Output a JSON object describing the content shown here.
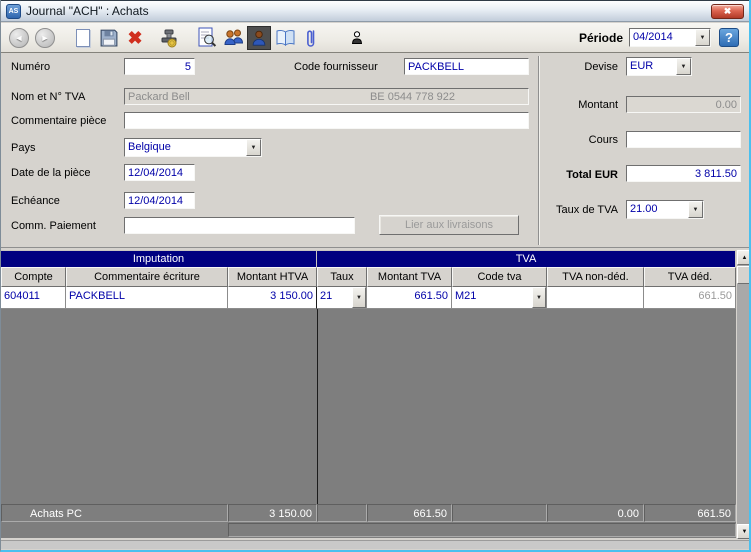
{
  "colors": {
    "group_header": "#000080",
    "entry_text": "#0000A8",
    "window_bg": "#D6D3CE",
    "table_empty_bg": "#7E7E7E",
    "close_button_red": "#C2402C",
    "window_edge_cyan": "#4AC0EF"
  },
  "glyphs": {
    "app_badge": "AS",
    "close": "✖",
    "back": "◄",
    "forward": "►",
    "delete": "✖",
    "dropdown": "▼",
    "scroll_up": "▲",
    "scroll_down": "▼",
    "help": "?"
  },
  "window": {
    "title": "Journal \"ACH\" : Achats"
  },
  "toolbar": {
    "period_label": "Période",
    "period_value": "04/2014"
  },
  "form": {
    "numero_label": "Numéro",
    "numero_value": "5",
    "code_fournisseur_label": "Code fournisseur",
    "code_fournisseur_value": "PACKBELL",
    "nom_tva_label": "Nom et N° TVA",
    "nom_tva_name": "Packard Bell",
    "nom_tva_number": "BE 0544 778 922",
    "commentaire_label": "Commentaire pièce",
    "commentaire_value": "",
    "pays_label": "Pays",
    "pays_value": "Belgique",
    "date_piece_label": "Date de la pièce",
    "date_piece_value": "12/04/2014",
    "echeance_label": "Echéance",
    "echeance_value": "12/04/2014",
    "comm_paiement_label": "Comm. Paiement",
    "comm_paiement_value": "",
    "lier_button_label": "Lier aux livraisons"
  },
  "totals": {
    "devise_label": "Devise",
    "devise_value": "EUR",
    "montant_label": "Montant",
    "montant_value": "0.00",
    "cours_label": "Cours",
    "cours_value": "",
    "total_label": "Total EUR",
    "total_value": "3 811.50",
    "taux_label": "Taux de TVA",
    "taux_value": "21.00"
  },
  "table": {
    "group_imputation": "Imputation",
    "group_tva": "TVA",
    "columns": [
      "Compte",
      "Commentaire écriture",
      "Montant HTVA",
      "Taux",
      "Montant TVA",
      "Code tva",
      "TVA non-déd.",
      "TVA déd."
    ],
    "rows": [
      {
        "compte": "604011",
        "commentaire": "PACKBELL",
        "montant_htva": "3 150.00",
        "taux": "21",
        "montant_tva": "661.50",
        "code_tva": "M21",
        "tva_non_ded": "",
        "tva_ded": "661.50"
      }
    ],
    "summary": {
      "label": "Achats PC",
      "montant_htva": "3 150.00",
      "montant_tva": "661.50",
      "tva_non_ded": "0.00",
      "tva_ded": "661.50"
    }
  }
}
